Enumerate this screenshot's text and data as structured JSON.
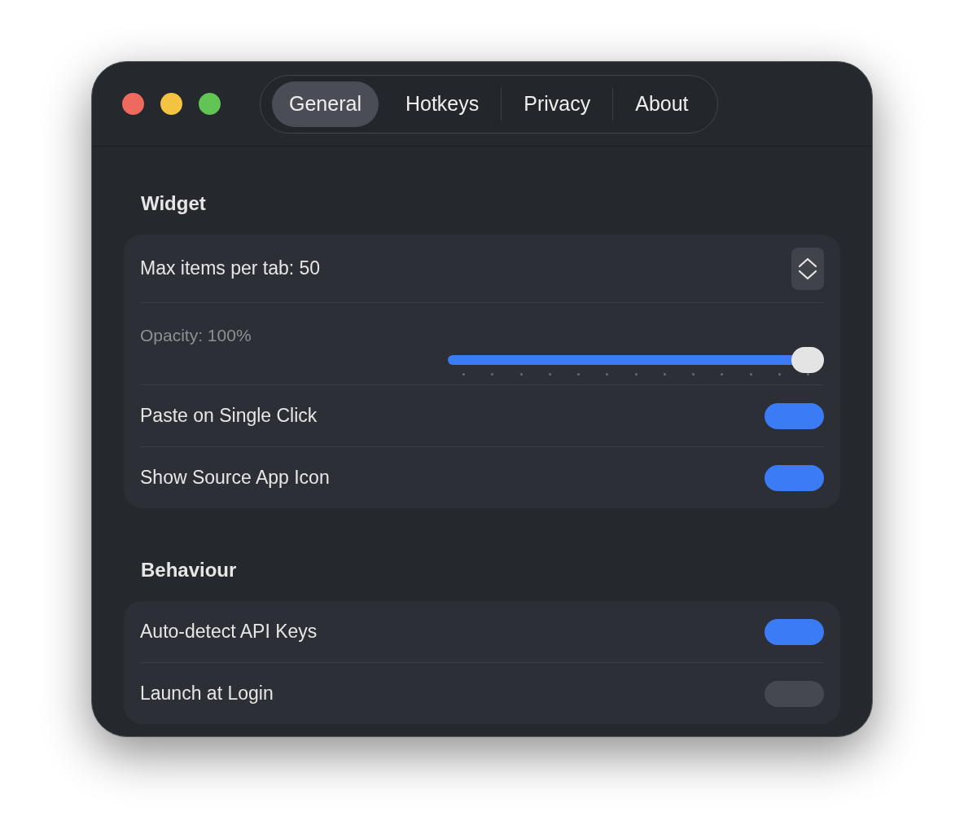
{
  "tabs": [
    {
      "label": "General",
      "selected": true
    },
    {
      "label": "Hotkeys",
      "selected": false
    },
    {
      "label": "Privacy",
      "selected": false
    },
    {
      "label": "About",
      "selected": false
    }
  ],
  "sections": [
    {
      "title": "Widget",
      "rows": [
        {
          "kind": "stepper",
          "label": "Max items per tab: 50"
        },
        {
          "kind": "slider",
          "label": "Opacity: 100%",
          "level": 1
        },
        {
          "kind": "toggle",
          "label": "Paste on Single Click",
          "on": true
        },
        {
          "kind": "toggle",
          "label": "Show Source App Icon",
          "on": true
        }
      ]
    },
    {
      "title": "Behaviour",
      "rows": [
        {
          "kind": "toggle",
          "label": "Auto-detect API Keys",
          "on": true
        },
        {
          "kind": "toggle",
          "label": "Launch at Login",
          "on": false
        }
      ]
    }
  ]
}
